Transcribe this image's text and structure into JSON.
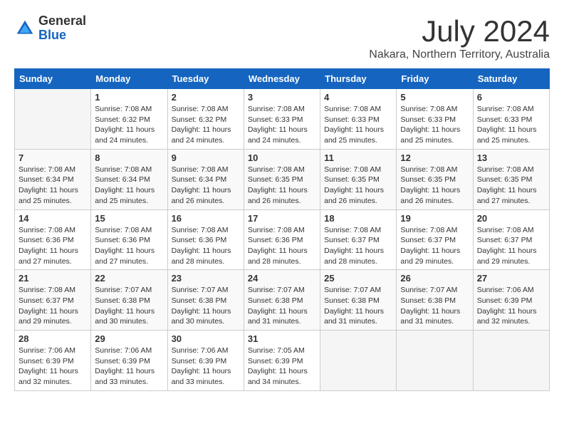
{
  "logo": {
    "general": "General",
    "blue": "Blue"
  },
  "header": {
    "month": "July 2024",
    "location": "Nakara, Northern Territory, Australia"
  },
  "days_of_week": [
    "Sunday",
    "Monday",
    "Tuesday",
    "Wednesday",
    "Thursday",
    "Friday",
    "Saturday"
  ],
  "weeks": [
    [
      {
        "day": "",
        "info": ""
      },
      {
        "day": "1",
        "info": "Sunrise: 7:08 AM\nSunset: 6:32 PM\nDaylight: 11 hours\nand 24 minutes."
      },
      {
        "day": "2",
        "info": "Sunrise: 7:08 AM\nSunset: 6:32 PM\nDaylight: 11 hours\nand 24 minutes."
      },
      {
        "day": "3",
        "info": "Sunrise: 7:08 AM\nSunset: 6:33 PM\nDaylight: 11 hours\nand 24 minutes."
      },
      {
        "day": "4",
        "info": "Sunrise: 7:08 AM\nSunset: 6:33 PM\nDaylight: 11 hours\nand 25 minutes."
      },
      {
        "day": "5",
        "info": "Sunrise: 7:08 AM\nSunset: 6:33 PM\nDaylight: 11 hours\nand 25 minutes."
      },
      {
        "day": "6",
        "info": "Sunrise: 7:08 AM\nSunset: 6:33 PM\nDaylight: 11 hours\nand 25 minutes."
      }
    ],
    [
      {
        "day": "7",
        "info": "Sunrise: 7:08 AM\nSunset: 6:34 PM\nDaylight: 11 hours\nand 25 minutes."
      },
      {
        "day": "8",
        "info": "Sunrise: 7:08 AM\nSunset: 6:34 PM\nDaylight: 11 hours\nand 25 minutes."
      },
      {
        "day": "9",
        "info": "Sunrise: 7:08 AM\nSunset: 6:34 PM\nDaylight: 11 hours\nand 26 minutes."
      },
      {
        "day": "10",
        "info": "Sunrise: 7:08 AM\nSunset: 6:35 PM\nDaylight: 11 hours\nand 26 minutes."
      },
      {
        "day": "11",
        "info": "Sunrise: 7:08 AM\nSunset: 6:35 PM\nDaylight: 11 hours\nand 26 minutes."
      },
      {
        "day": "12",
        "info": "Sunrise: 7:08 AM\nSunset: 6:35 PM\nDaylight: 11 hours\nand 26 minutes."
      },
      {
        "day": "13",
        "info": "Sunrise: 7:08 AM\nSunset: 6:35 PM\nDaylight: 11 hours\nand 27 minutes."
      }
    ],
    [
      {
        "day": "14",
        "info": "Sunrise: 7:08 AM\nSunset: 6:36 PM\nDaylight: 11 hours\nand 27 minutes."
      },
      {
        "day": "15",
        "info": "Sunrise: 7:08 AM\nSunset: 6:36 PM\nDaylight: 11 hours\nand 27 minutes."
      },
      {
        "day": "16",
        "info": "Sunrise: 7:08 AM\nSunset: 6:36 PM\nDaylight: 11 hours\nand 28 minutes."
      },
      {
        "day": "17",
        "info": "Sunrise: 7:08 AM\nSunset: 6:36 PM\nDaylight: 11 hours\nand 28 minutes."
      },
      {
        "day": "18",
        "info": "Sunrise: 7:08 AM\nSunset: 6:37 PM\nDaylight: 11 hours\nand 28 minutes."
      },
      {
        "day": "19",
        "info": "Sunrise: 7:08 AM\nSunset: 6:37 PM\nDaylight: 11 hours\nand 29 minutes."
      },
      {
        "day": "20",
        "info": "Sunrise: 7:08 AM\nSunset: 6:37 PM\nDaylight: 11 hours\nand 29 minutes."
      }
    ],
    [
      {
        "day": "21",
        "info": "Sunrise: 7:08 AM\nSunset: 6:37 PM\nDaylight: 11 hours\nand 29 minutes."
      },
      {
        "day": "22",
        "info": "Sunrise: 7:07 AM\nSunset: 6:38 PM\nDaylight: 11 hours\nand 30 minutes."
      },
      {
        "day": "23",
        "info": "Sunrise: 7:07 AM\nSunset: 6:38 PM\nDaylight: 11 hours\nand 30 minutes."
      },
      {
        "day": "24",
        "info": "Sunrise: 7:07 AM\nSunset: 6:38 PM\nDaylight: 11 hours\nand 31 minutes."
      },
      {
        "day": "25",
        "info": "Sunrise: 7:07 AM\nSunset: 6:38 PM\nDaylight: 11 hours\nand 31 minutes."
      },
      {
        "day": "26",
        "info": "Sunrise: 7:07 AM\nSunset: 6:38 PM\nDaylight: 11 hours\nand 31 minutes."
      },
      {
        "day": "27",
        "info": "Sunrise: 7:06 AM\nSunset: 6:39 PM\nDaylight: 11 hours\nand 32 minutes."
      }
    ],
    [
      {
        "day": "28",
        "info": "Sunrise: 7:06 AM\nSunset: 6:39 PM\nDaylight: 11 hours\nand 32 minutes."
      },
      {
        "day": "29",
        "info": "Sunrise: 7:06 AM\nSunset: 6:39 PM\nDaylight: 11 hours\nand 33 minutes."
      },
      {
        "day": "30",
        "info": "Sunrise: 7:06 AM\nSunset: 6:39 PM\nDaylight: 11 hours\nand 33 minutes."
      },
      {
        "day": "31",
        "info": "Sunrise: 7:05 AM\nSunset: 6:39 PM\nDaylight: 11 hours\nand 34 minutes."
      },
      {
        "day": "",
        "info": ""
      },
      {
        "day": "",
        "info": ""
      },
      {
        "day": "",
        "info": ""
      }
    ]
  ]
}
